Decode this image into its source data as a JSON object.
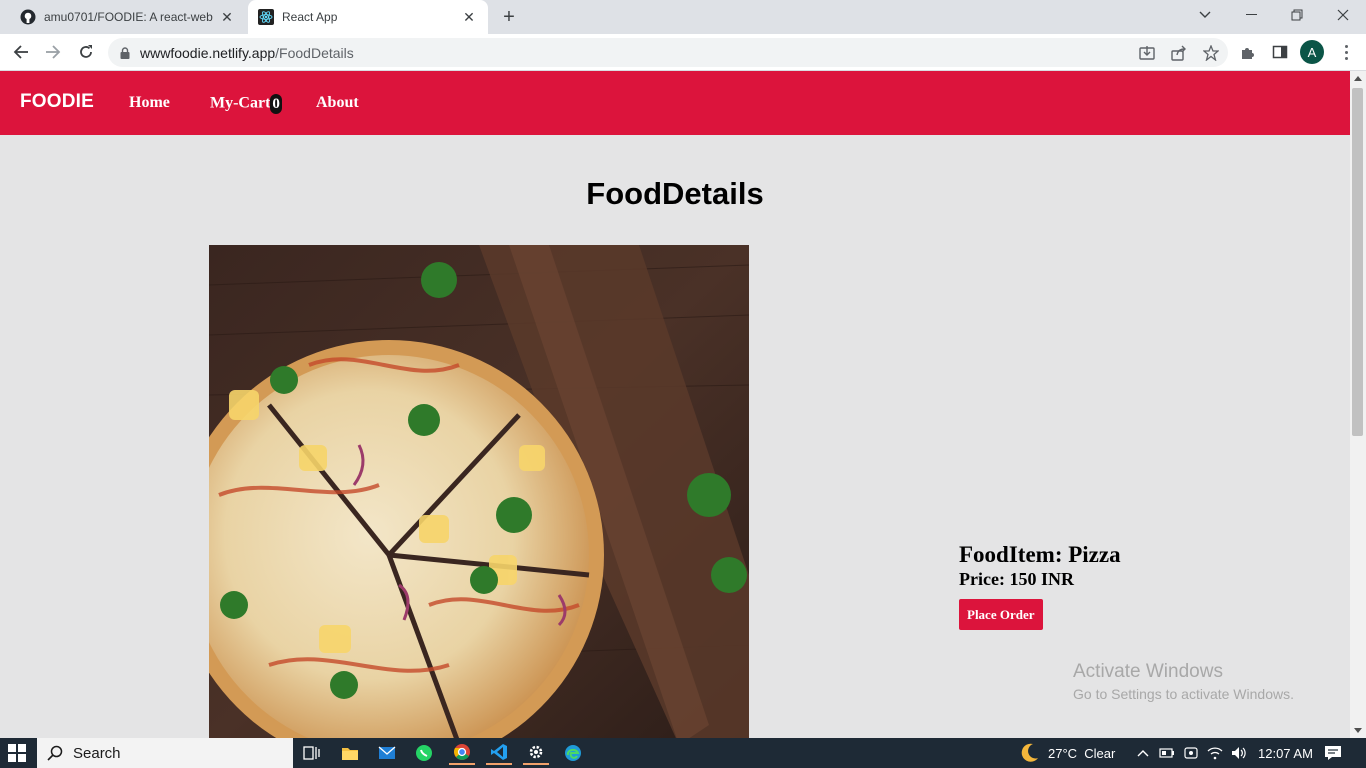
{
  "browser": {
    "tabs": [
      {
        "title": "amu0701/FOODIE: A react-web a",
        "favicon": "github-icon",
        "active": false
      },
      {
        "title": "React App",
        "favicon": "react-icon",
        "active": true
      }
    ],
    "url_host": "wwwfoodie.netlify.app",
    "url_path": "/FoodDetails",
    "profile_initial": "A"
  },
  "app": {
    "brand": "FOODIE",
    "nav": {
      "home": "Home",
      "cart": "My-Cart",
      "cart_count": "0",
      "about": "About"
    },
    "page_title": "FoodDetails",
    "food": {
      "item_label": "FoodItem: Pizza",
      "price_label": "Price: 150 INR",
      "order_button": "Place Order"
    },
    "colors": {
      "primary": "#dc143c",
      "background": "#e4e4e5"
    }
  },
  "watermark": {
    "title": "Activate Windows",
    "subtitle": "Go to Settings to activate Windows."
  },
  "taskbar": {
    "search_placeholder": "Search",
    "weather": "27°C  Clear",
    "time": "12:07 AM"
  }
}
